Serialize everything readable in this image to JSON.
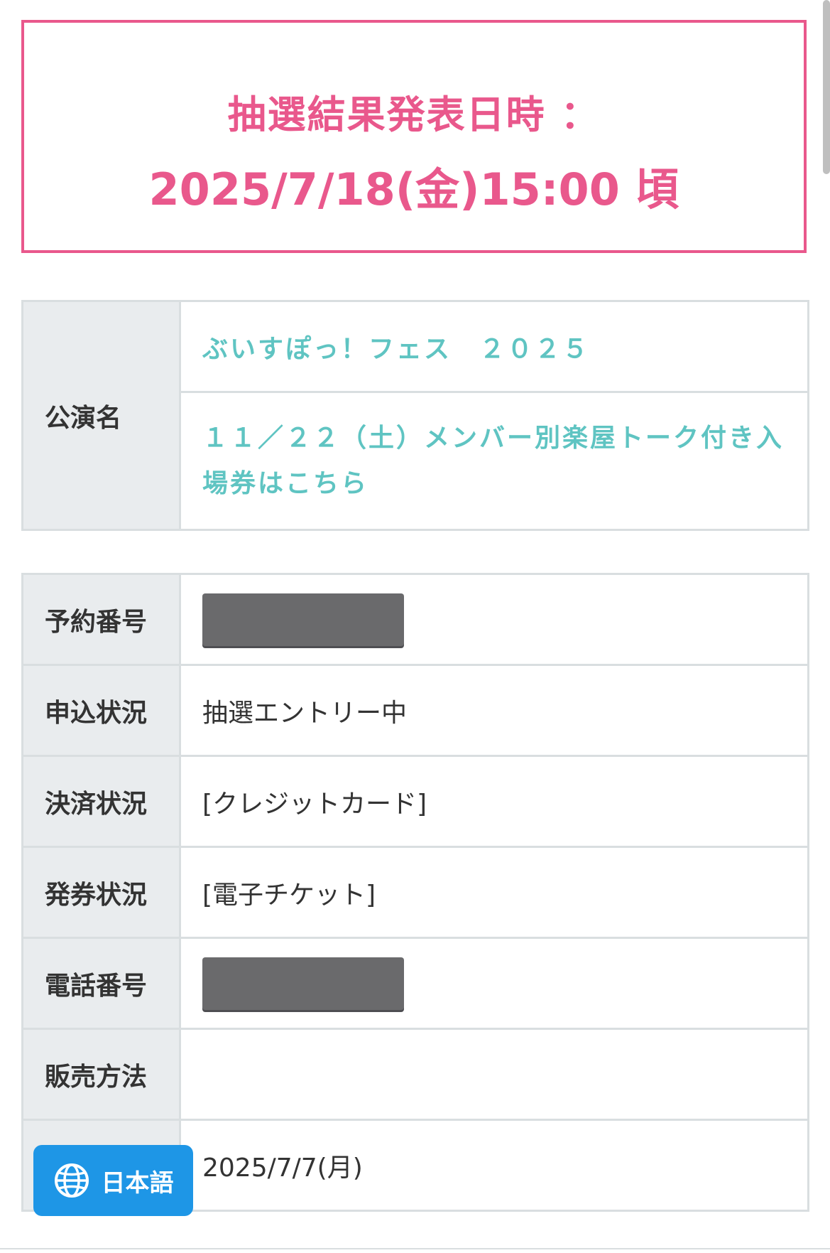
{
  "announcement": {
    "label": "抽選結果発表日時 ：",
    "datetime": "2025/7/18(金)15:00 頃",
    "accent_color": "#e9588c"
  },
  "performance": {
    "label": "公演名",
    "title": "ぶいすぽっ！フェス　２０２５",
    "subtitle": "１１／２２（土）メンバー別楽屋トーク付き入場券はこちら",
    "link_color": "#5fc4c2"
  },
  "details": [
    {
      "label": "予約番号",
      "value": "",
      "redacted": true
    },
    {
      "label": "申込状況",
      "value": "抽選エントリー中",
      "redacted": false
    },
    {
      "label": "決済状況",
      "value": "[クレジットカード]",
      "redacted": false
    },
    {
      "label": "発券状況",
      "value": "[電子チケット]",
      "redacted": false
    },
    {
      "label": "電話番号",
      "value": "",
      "redacted": true
    },
    {
      "label": "販売方法",
      "value": "",
      "redacted": false
    },
    {
      "label": "",
      "value": "2025/7/7(月)",
      "redacted": false
    }
  ],
  "language_button": {
    "label": "日本語",
    "icon": "globe-icon",
    "color": "#1e96e6"
  }
}
